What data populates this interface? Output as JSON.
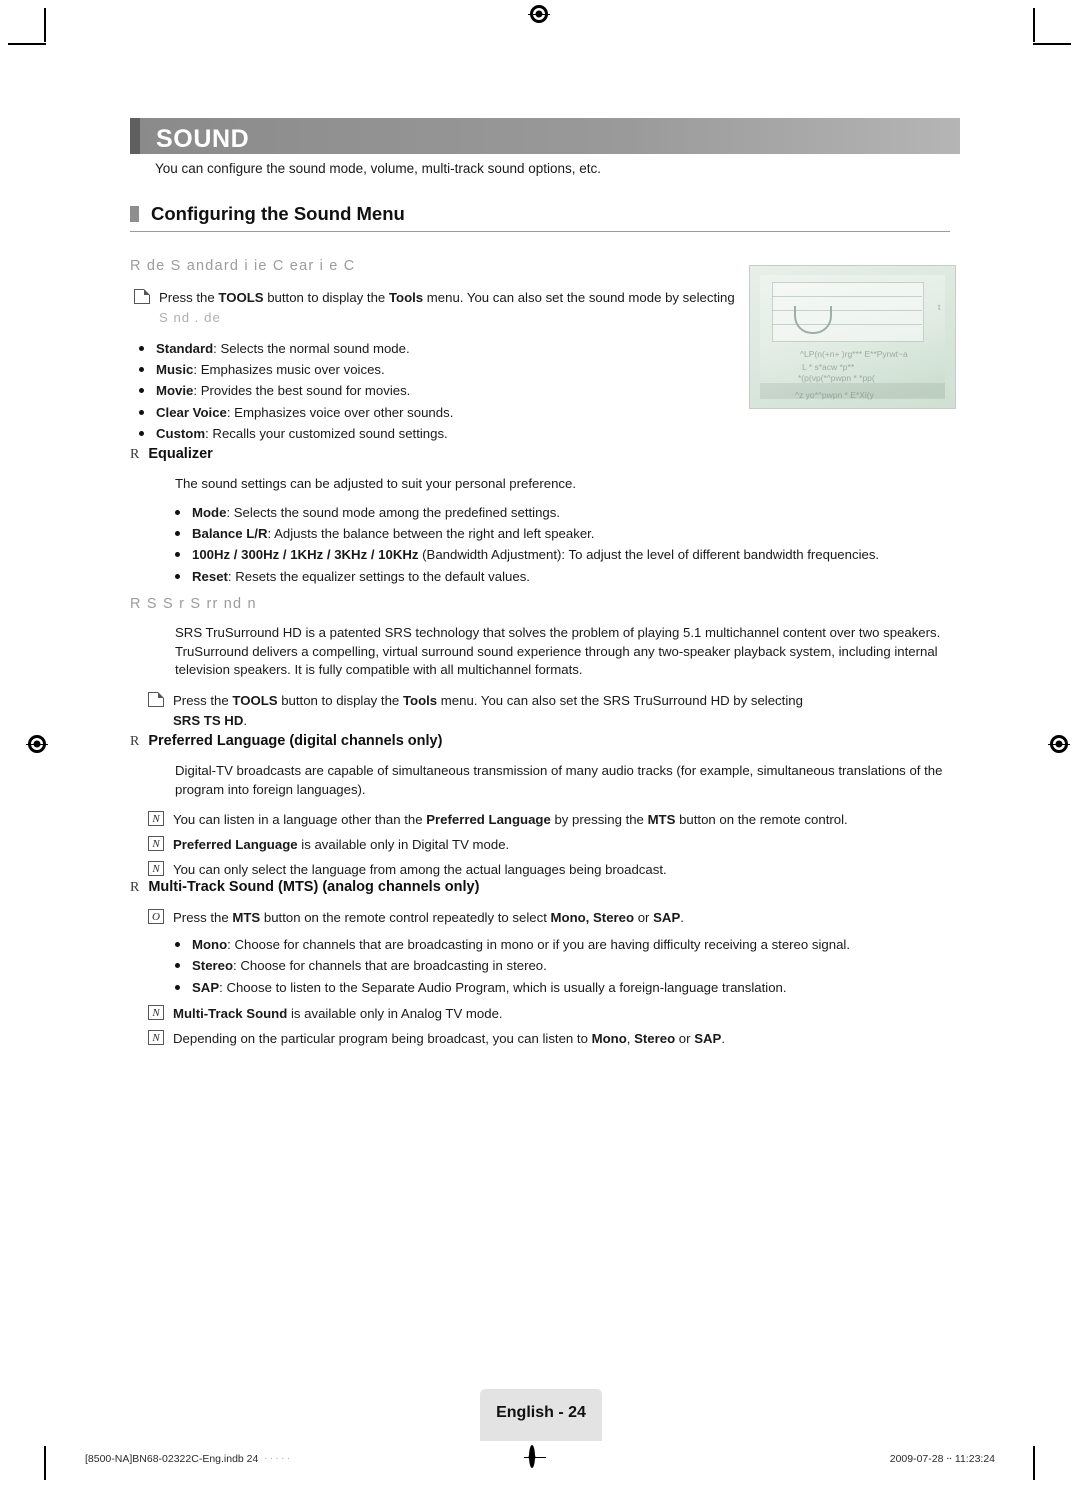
{
  "document": {
    "section_title": "SOUND",
    "section_intro": "You can configure the sound mode, volume, multi-track sound options, etc.",
    "heading": "Configuring the Sound Menu",
    "sound_mode": {
      "heading_faded": "R    de   S  andard                i                   ie    C  ear     i  e    C",
      "tools_note": "Press the TOOLS button to display the Tools menu. You can also set the sound mode by selecting                    S   nd .   de",
      "tools_note_part1": "Press the ",
      "tools_note_tools1": "TOOLS",
      "tools_note_part2": " button to display the ",
      "tools_note_tools2": "Tools",
      "tools_note_part3": " menu. You can also set the sound mode by selecting ",
      "tools_note_faded": "S   nd .   de",
      "items": [
        {
          "term": "Standard",
          "desc": ": Selects the normal sound mode."
        },
        {
          "term": "Music",
          "desc": ": Emphasizes music over voices."
        },
        {
          "term": "Movie",
          "desc": ": Provides the best sound for movies."
        },
        {
          "term": "Clear Voice",
          "desc": ": Emphasizes voice over other sounds."
        },
        {
          "term": "Custom",
          "desc": ": Recalls your customized sound settings."
        }
      ]
    },
    "equalizer": {
      "heading": "Equalizer",
      "intro": "The sound settings can be adjusted to suit your personal preference.",
      "items": [
        {
          "term": "Mode",
          "desc": ": Selects the sound mode among the predefined settings."
        },
        {
          "term": "Balance L/R",
          "desc": ": Adjusts the balance between the right and left speaker."
        },
        {
          "term": "100Hz / 300Hz / 1KHz / 3KHz / 10KHz",
          "desc": " (Bandwidth Adjustment): To adjust the level of different bandwidth frequencies."
        },
        {
          "term": "Reset",
          "desc": ": Resets the equalizer settings to the default values."
        }
      ]
    },
    "srs": {
      "heading_faded": "R  S   S   r  S   rr    nd                                       n",
      "paragraph": "SRS TruSurround HD is a patented SRS technology that solves the problem of playing 5.1 multichannel content over two speakers. TruSurround delivers a compelling, virtual surround sound experience through any two-speaker playback system, including internal television speakers. It is fully compatible with all multichannel formats.",
      "note_part1": "Press the ",
      "note_tools1": "TOOLS",
      "note_part2": " button to display the ",
      "note_tools2": "Tools",
      "note_part3": " menu. You can also set the SRS TruSurround HD by selecting ",
      "note_bold": "SRS TS HD",
      "note_end": "."
    },
    "preferred_language": {
      "heading": "Preferred Language (digital channels only)",
      "paragraph": "Digital-TV broadcasts are capable of simultaneous transmission of many audio tracks (for example, simultaneous translations of the program into foreign languages).",
      "notes": [
        {
          "pre": "You can listen in a language other than the ",
          "b1": "Preferred Language",
          "mid": " by pressing the ",
          "b2": "MTS",
          "post": " button on the remote control."
        },
        {
          "pre": "",
          "b1": "Preferred Language",
          "mid": " is available only in Digital TV mode.",
          "b2": "",
          "post": ""
        },
        {
          "pre": "You can only select the language from among the actual languages being broadcast.",
          "b1": "",
          "mid": "",
          "b2": "",
          "post": ""
        }
      ]
    },
    "mts": {
      "heading": "Multi-Track Sound (MTS) (analog channels only)",
      "top_note": {
        "pre": "Press the ",
        "b1": "MTS",
        "mid": " button on the remote control repeatedly to select ",
        "b2": "Mono, Stereo",
        "mid2": " or ",
        "b3": "SAP",
        "post": "."
      },
      "items": [
        {
          "term": "Mono",
          "desc": ": Choose for channels that are broadcasting in mono or if you are having difficulty receiving a stereo signal."
        },
        {
          "term": "Stereo",
          "desc": ": Choose for channels that are broadcasting in stereo."
        },
        {
          "term": "SAP",
          "desc": ": Choose to listen to the Separate Audio Program, which is usually a foreign-language translation."
        }
      ],
      "notes": [
        {
          "b1": "Multi-Track Sound",
          "post": " is available only in Analog TV mode."
        },
        {
          "pre": "Depending on the particular program being broadcast, you can listen to ",
          "b1": "Mono",
          "mid": ", ",
          "b2": "Stereo",
          "mid2": " or ",
          "b3": "SAP",
          "post": "."
        }
      ]
    },
    "tv_image": {
      "label1": "^LP(n(+n+     )rg***    E**Pyrwt~a",
      "label2": "L * s*acw *p**",
      "label3": "*(p(vp(*^pwpn *                                      *pp(",
      "label4": "^z  yo*^pwpn *      E*Xi(y",
      "label5": "t"
    },
    "footer": {
      "page_label": "English - 24",
      "left": "[8500-NA]BN68-02322C-Eng.indb   24",
      "left_ghost": "⸱ ⸱ ⸱ ⸱ ⸱",
      "right": "2009-07-28   ⸱⸱ 11:23:24"
    }
  }
}
